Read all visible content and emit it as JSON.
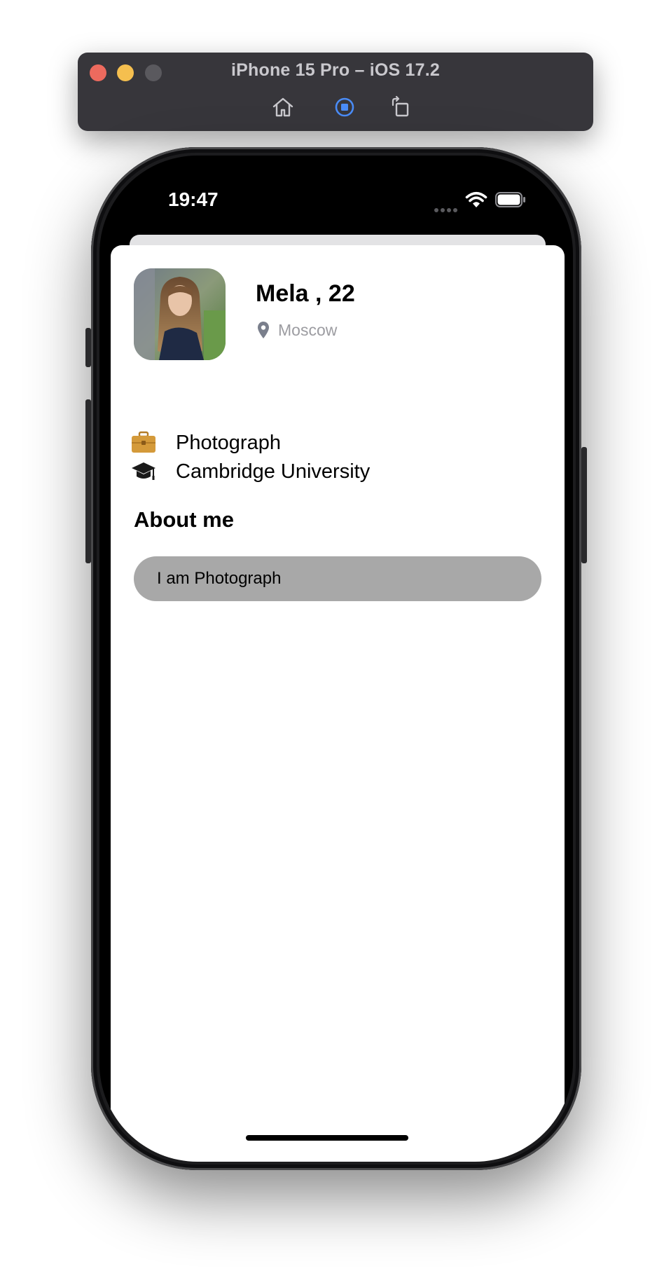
{
  "simulator": {
    "title": "iPhone 15 Pro – iOS 17.2",
    "buttons": [
      "home-icon",
      "screenshot-icon",
      "rotate-icon"
    ],
    "accent": "#4a8cf7"
  },
  "status_bar": {
    "time": "19:47"
  },
  "profile": {
    "name": "Mela , 22",
    "location": "Moscow",
    "job": "Photograph",
    "education": "Cambridge University"
  },
  "about": {
    "title": "About me",
    "text": "I am Photograph"
  },
  "colors": {
    "about_box": "#a8a8a8",
    "briefcase": "#d49a3a",
    "location_text": "#9c9ca1"
  }
}
